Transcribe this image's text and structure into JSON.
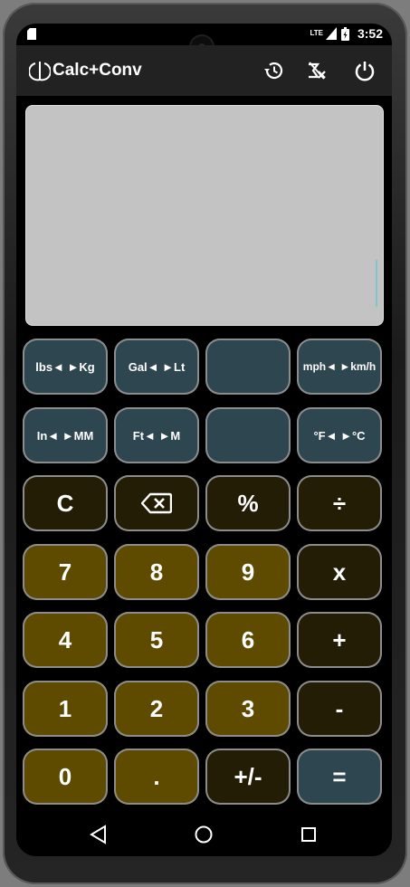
{
  "status_bar": {
    "network": "LTE",
    "time": "3:52"
  },
  "app_bar": {
    "title": "Calc+Conv",
    "icons": [
      "calculator-logo-icon",
      "history-icon",
      "clear-history-icon",
      "power-icon"
    ]
  },
  "display": {
    "text": ""
  },
  "keys": {
    "conversion_row_1": [
      "lbs◄ ►Kg",
      "Gal◄ ►Lt",
      "",
      "mph◄ ►km/h"
    ],
    "conversion_row_2": [
      "In◄ ►MM",
      "Ft◄ ►M",
      "",
      "°F◄ ►°C"
    ],
    "clear": "C",
    "backspace_icon": "backspace-icon",
    "percent": "%",
    "divide": "÷",
    "multiply": "x",
    "plus": "+",
    "minus": "-",
    "equals": "=",
    "plus_minus": "+/-",
    "decimal": ".",
    "digits": [
      "0",
      "1",
      "2",
      "3",
      "4",
      "5",
      "6",
      "7",
      "8",
      "9"
    ]
  },
  "colors": {
    "conversion_key": "#2e4650",
    "operator_key": "#231d06",
    "digit_key": "#5e4b00",
    "display_bg": "#c3c3c3"
  }
}
